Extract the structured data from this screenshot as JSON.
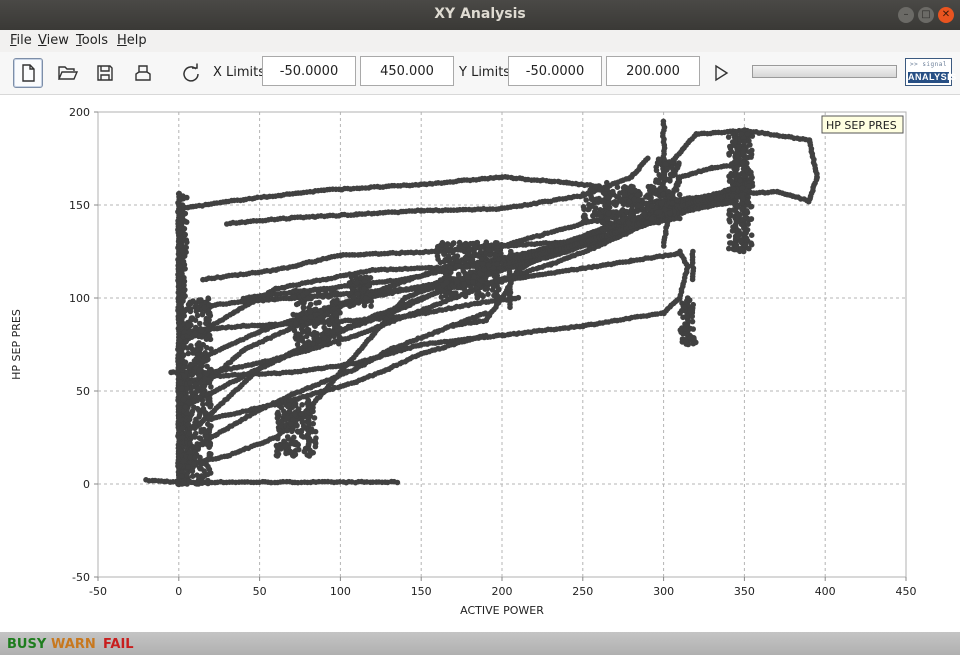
{
  "window": {
    "title": "XY Analysis"
  },
  "menu": [
    "File",
    "View",
    "Tools",
    "Help"
  ],
  "toolbar": {
    "x_limits_label": "X Limits",
    "x_min": "-50.0000",
    "x_max": "450.000",
    "y_limits_label": "Y Limits",
    "y_min": "-50.0000",
    "y_max": "200.000",
    "progress": 0
  },
  "logo": {
    "top_text": ">> signal",
    "bottom_text": "ANALYSIS"
  },
  "status": {
    "busy": "BUSY",
    "warn": "WARN",
    "fail": "FAIL"
  },
  "colors": {
    "busy": "#1e7d1e",
    "warn": "#c8781e",
    "fail": "#c81e1e",
    "points": "#414141",
    "grid": "#b4b4b4"
  },
  "chart_data": {
    "type": "scatter",
    "xlabel": "ACTIVE POWER",
    "ylabel": "HP SEP PRES",
    "xlim": [
      -50,
      450
    ],
    "ylim": [
      -50,
      200
    ],
    "xticks": [
      -50,
      0,
      50,
      100,
      150,
      200,
      250,
      300,
      350,
      400,
      450
    ],
    "yticks": [
      -50,
      0,
      50,
      100,
      150,
      200
    ],
    "grid": true,
    "legend": {
      "label": "HP SEP PRES",
      "position": "top-right"
    },
    "series": [
      {
        "name": "HP SEP PRES",
        "segments": [
          [
            [
              -20,
              2
            ],
            [
              0,
              1
            ],
            [
              135,
              1
            ]
          ],
          [
            [
              0,
              0
            ],
            [
              0,
              156
            ]
          ],
          [
            [
              0,
              25
            ],
            [
              5,
              55
            ],
            [
              20,
              58
            ],
            [
              70,
              60
            ],
            [
              110,
              65
            ],
            [
              150,
              75
            ],
            [
              200,
              80
            ],
            [
              250,
              85
            ],
            [
              300,
              92
            ],
            [
              310,
              100
            ],
            [
              315,
              117
            ],
            [
              310,
              125
            ]
          ],
          [
            [
              0,
              56
            ],
            [
              15,
              68
            ],
            [
              50,
              82
            ],
            [
              100,
              97
            ],
            [
              160,
              108
            ],
            [
              190,
              112
            ]
          ],
          [
            [
              0,
              148
            ],
            [
              40,
              153
            ],
            [
              90,
              158
            ],
            [
              150,
              161
            ],
            [
              200,
              165
            ],
            [
              240,
              162
            ],
            [
              260,
              160
            ],
            [
              280,
              150
            ],
            [
              300,
              152
            ],
            [
              340,
              156
            ],
            [
              370,
              157
            ],
            [
              380,
              155
            ],
            [
              390,
              152
            ],
            [
              395,
              165
            ],
            [
              390,
              185
            ],
            [
              350,
              190
            ],
            [
              320,
              188
            ],
            [
              300,
              168
            ]
          ],
          [
            [
              0,
              75
            ],
            [
              60,
              105
            ],
            [
              120,
              115
            ],
            [
              180,
              117
            ],
            [
              220,
              122
            ],
            [
              260,
              130
            ],
            [
              290,
              145
            ],
            [
              310,
              150
            ]
          ],
          [
            [
              5,
              45
            ],
            [
              40,
              72
            ],
            [
              80,
              88
            ],
            [
              120,
              103
            ],
            [
              160,
              115
            ],
            [
              200,
              128
            ],
            [
              250,
              140
            ],
            [
              300,
              150
            ],
            [
              330,
              155
            ],
            [
              355,
              160
            ]
          ],
          [
            [
              10,
              30
            ],
            [
              50,
              62
            ],
            [
              100,
              82
            ],
            [
              140,
              95
            ],
            [
              180,
              112
            ],
            [
              220,
              122
            ],
            [
              260,
              135
            ],
            [
              300,
              148
            ],
            [
              340,
              158
            ],
            [
              355,
              162
            ]
          ],
          [
            [
              0,
              40
            ],
            [
              40,
              58
            ],
            [
              80,
              75
            ],
            [
              120,
              90
            ],
            [
              160,
              103
            ],
            [
              200,
              115
            ],
            [
              240,
              125
            ],
            [
              280,
              138
            ],
            [
              320,
              150
            ],
            [
              350,
              155
            ]
          ],
          [
            [
              5,
              82
            ],
            [
              40,
              85
            ],
            [
              70,
              86
            ],
            [
              110,
              88
            ],
            [
              140,
              90
            ],
            [
              190,
              98
            ],
            [
              210,
              100
            ]
          ],
          [
            [
              15,
              110
            ],
            [
              60,
              115
            ],
            [
              100,
              123
            ],
            [
              160,
              125
            ],
            [
              200,
              128
            ],
            [
              240,
              130
            ],
            [
              270,
              140
            ],
            [
              300,
              145
            ]
          ],
          [
            [
              30,
              140
            ],
            [
              70,
              143
            ],
            [
              110,
              145
            ],
            [
              150,
              147
            ],
            [
              200,
              148
            ],
            [
              250,
              155
            ],
            [
              280,
              165
            ],
            [
              290,
              175
            ]
          ],
          [
            [
              170,
              85
            ],
            [
              190,
              88
            ],
            [
              200,
              100
            ],
            [
              210,
              115
            ],
            [
              220,
              120
            ],
            [
              240,
              125
            ]
          ],
          [
            [
              40,
              100
            ],
            [
              90,
              105
            ],
            [
              140,
              110
            ],
            [
              180,
              118
            ],
            [
              220,
              125
            ],
            [
              250,
              133
            ],
            [
              290,
              145
            ],
            [
              315,
              152
            ]
          ],
          [
            [
              0,
              10
            ],
            [
              30,
              15
            ],
            [
              60,
              25
            ],
            [
              80,
              40
            ],
            [
              100,
              60
            ],
            [
              120,
              80
            ],
            [
              140,
              100
            ],
            [
              170,
              110
            ],
            [
              190,
              112
            ]
          ],
          [
            [
              -5,
              60
            ],
            [
              20,
              60
            ],
            [
              50,
              65
            ],
            [
              80,
              72
            ],
            [
              110,
              80
            ],
            [
              140,
              90
            ],
            [
              170,
              100
            ],
            [
              200,
              110
            ],
            [
              230,
              118
            ],
            [
              260,
              128
            ],
            [
              290,
              140
            ],
            [
              320,
              148
            ],
            [
              345,
              152
            ]
          ],
          [
            [
              300,
              128
            ],
            [
              305,
              155
            ],
            [
              310,
              165
            ],
            [
              330,
              170
            ],
            [
              350,
              172
            ],
            [
              355,
              165
            ]
          ],
          [
            [
              10,
              20
            ],
            [
              30,
              30
            ],
            [
              50,
              40
            ],
            [
              70,
              48
            ],
            [
              90,
              55
            ],
            [
              110,
              62
            ],
            [
              130,
              72
            ],
            [
              160,
              82
            ],
            [
              190,
              92
            ]
          ],
          [
            [
              10,
              95
            ],
            [
              40,
              98
            ],
            [
              70,
              100
            ],
            [
              100,
              102
            ],
            [
              130,
              104
            ],
            [
              160,
              106
            ],
            [
              190,
              108
            ],
            [
              220,
              112
            ],
            [
              250,
              116
            ],
            [
              280,
              120
            ],
            [
              310,
              124
            ]
          ],
          [
            [
              20,
              35
            ],
            [
              45,
              40
            ],
            [
              70,
              45
            ],
            [
              90,
              50
            ],
            [
              110,
              55
            ],
            [
              130,
              62
            ],
            [
              150,
              70
            ],
            [
              170,
              75
            ],
            [
              190,
              80
            ]
          ],
          [
            [
              200,
              120
            ],
            [
              220,
              123
            ],
            [
              240,
              127
            ],
            [
              260,
              132
            ],
            [
              275,
              138
            ],
            [
              290,
              140
            ],
            [
              310,
              143
            ]
          ],
          [
            [
              250,
              130
            ],
            [
              270,
              135
            ],
            [
              285,
              140
            ],
            [
              300,
              146
            ],
            [
              320,
              152
            ],
            [
              340,
              155
            ],
            [
              350,
              158
            ]
          ]
        ],
        "clusters": [
          [
            0,
            5,
            0,
            156
          ],
          [
            5,
            20,
            0,
            100
          ],
          [
            60,
            85,
            15,
            45
          ],
          [
            70,
            100,
            75,
            105
          ],
          [
            160,
            200,
            100,
            130
          ],
          [
            250,
            300,
            140,
            160
          ],
          [
            295,
            310,
            145,
            175
          ],
          [
            340,
            355,
            125,
            190
          ],
          [
            310,
            320,
            75,
            100
          ],
          [
            105,
            120,
            95,
            112
          ]
        ],
        "vertical_runs": [
          [
            300,
            155,
            195
          ],
          [
            350,
            125,
            190
          ],
          [
            345,
            130,
            185
          ],
          [
            0,
            0,
            156
          ],
          [
            2,
            0,
            150
          ],
          [
            5,
            0,
            60
          ],
          [
            80,
            20,
            45
          ],
          [
            190,
            105,
            130
          ],
          [
            205,
            95,
            125
          ],
          [
            315,
            75,
            100
          ],
          [
            318,
            110,
            125
          ],
          [
            265,
            140,
            162
          ],
          [
            280,
            140,
            160
          ]
        ]
      }
    ]
  }
}
